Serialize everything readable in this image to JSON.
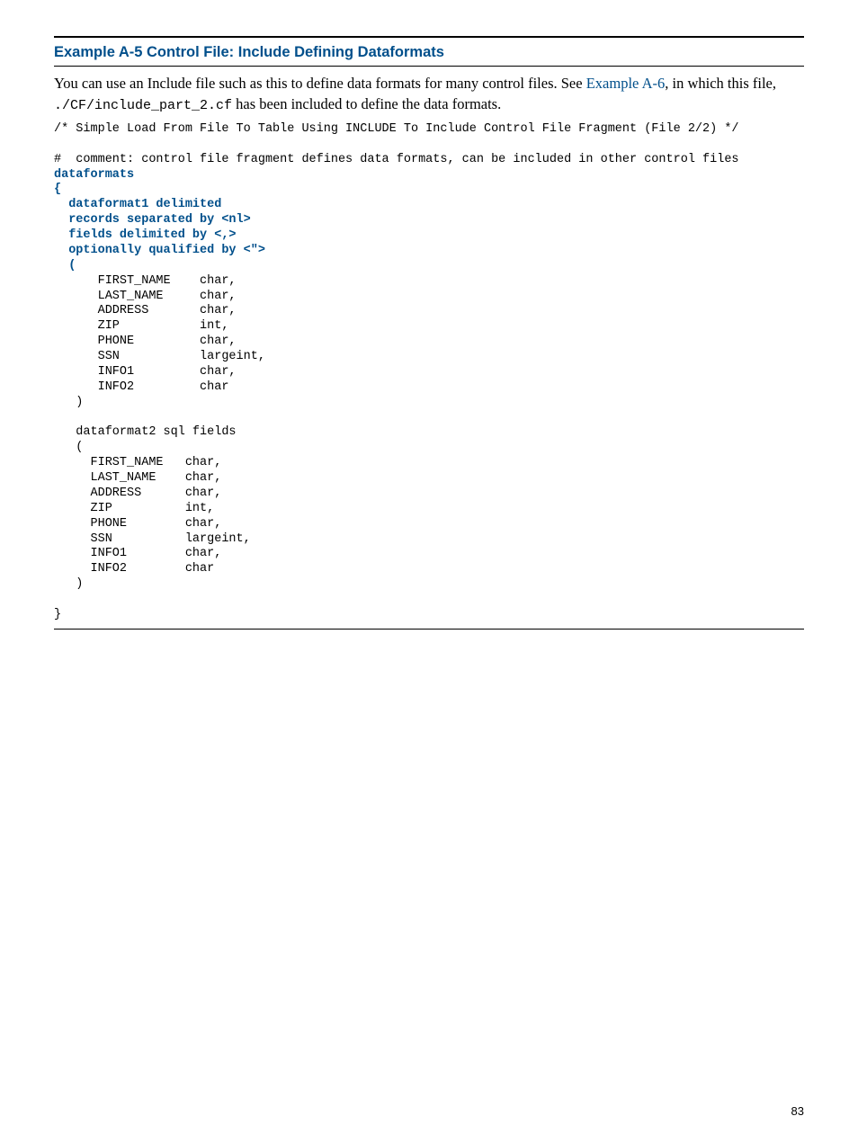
{
  "heading": "Example  A-5  Control File: Include Defining Dataformats",
  "body": {
    "para_prefix": "You can use an Include file such as this to define data formats for many control files. See ",
    "link_text": "Example A-6",
    "para_middle": ", in which this file, ",
    "inline_code": "./CF/include_part_2.cf",
    "para_suffix": " has been included to define the data formats."
  },
  "code": {
    "line1": "/* Simple Load From File To Table Using INCLUDE To Include Control File Fragment (File 2/2) */",
    "blank1": "",
    "line2": "#  comment: control file fragment defines data formats, can be included in other control files",
    "hl1": "dataformats",
    "hl2": "{",
    "hl3": "  dataformat1 delimited",
    "hl4": "  records separated by <nl>",
    "hl5": "  fields delimited by <,>",
    "hl6": "  optionally qualified by <\">",
    "hl7": "  (",
    "l8": "      FIRST_NAME    char,",
    "l9": "      LAST_NAME     char,",
    "l10": "      ADDRESS       char,",
    "l11": "      ZIP           int,",
    "l12": "      PHONE         char,",
    "l13": "      SSN           largeint,",
    "l14": "      INFO1         char,",
    "l15": "      INFO2         char",
    "l16": "   )",
    "blank2": "",
    "l17": "   dataformat2 sql fields",
    "l18": "   (",
    "l19": "     FIRST_NAME   char,",
    "l20": "     LAST_NAME    char,",
    "l21": "     ADDRESS      char,",
    "l22": "     ZIP          int,",
    "l23": "     PHONE        char,",
    "l24": "     SSN          largeint,",
    "l25": "     INFO1        char,",
    "l26": "     INFO2        char",
    "l27": "   )",
    "blank3": "",
    "l28": "}"
  },
  "page_number": "83"
}
